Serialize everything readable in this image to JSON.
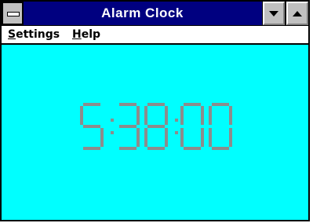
{
  "window": {
    "title": "Alarm Clock"
  },
  "menu": {
    "settings": {
      "mnemonic": "S",
      "rest": "ettings"
    },
    "help": {
      "mnemonic": "H",
      "rest": "elp"
    }
  },
  "clock": {
    "time": "5:38:00"
  },
  "colors": {
    "titlebar": "#000080",
    "client_background": "#00ffff",
    "digits": "#8c8c8c"
  },
  "icons": {
    "system_menu": "system-menu-icon",
    "minimize": "minimize-triangle-icon",
    "maximize": "maximize-triangle-icon"
  }
}
